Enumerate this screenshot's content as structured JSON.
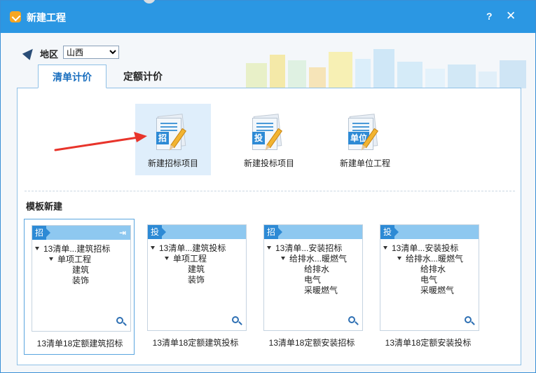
{
  "window": {
    "title": "新建工程",
    "help_label": "?",
    "close_label": "✕"
  },
  "region": {
    "label": "地区",
    "value": "山西",
    "options": [
      "山西"
    ]
  },
  "tabs": [
    {
      "label": "清单计价",
      "active": true
    },
    {
      "label": "定额计价",
      "active": false
    }
  ],
  "new_buttons": [
    {
      "tag": "招",
      "label": "新建招标项目",
      "icon": "bid-document-icon",
      "selected": true
    },
    {
      "tag": "投",
      "label": "新建投标项目",
      "icon": "tender-document-icon",
      "selected": false
    },
    {
      "tag": "单位",
      "label": "新建单位工程",
      "icon": "unit-document-icon",
      "selected": false
    }
  ],
  "template_section": {
    "title": "模板新建"
  },
  "templates": [
    {
      "tag": "招",
      "root": "13清单...建筑招标",
      "child": "单项工程",
      "leaves": [
        "建筑",
        "装饰"
      ],
      "caption": "13清单18定额建筑招标",
      "selected": true
    },
    {
      "tag": "投",
      "root": "13清单...建筑投标",
      "child": "单项工程",
      "leaves": [
        "建筑",
        "装饰"
      ],
      "caption": "13清单18定额建筑投标",
      "selected": false
    },
    {
      "tag": "招",
      "root": "13清单...安装招标",
      "child": "给排水...暖燃气",
      "leaves": [
        "给排水",
        "电气",
        "采暖燃气"
      ],
      "caption": "13清单18定额安装招标",
      "selected": false
    },
    {
      "tag": "投",
      "root": "13清单...安装投标",
      "child": "给排水...暖燃气",
      "leaves": [
        "给排水",
        "电气",
        "采暖燃气"
      ],
      "caption": "13清单18定额安装投标",
      "selected": false
    }
  ],
  "colors": {
    "titlebar": "#2b97e3",
    "accent": "#2d8ad5",
    "selected_bg": "#dfeefb",
    "annotation_arrow": "#e8342b"
  }
}
